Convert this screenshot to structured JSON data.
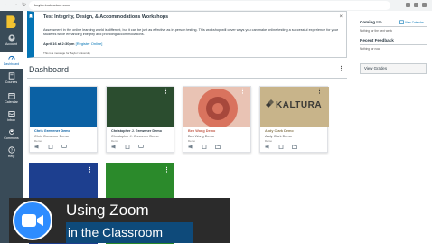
{
  "browser": {
    "url": "baylor.instructure.com"
  },
  "global_nav": {
    "items": [
      {
        "label": "Account",
        "icon": "account-icon"
      },
      {
        "label": "Dashboard",
        "icon": "dashboard-icon",
        "active": true
      },
      {
        "label": "Courses",
        "icon": "courses-icon"
      },
      {
        "label": "Calendar",
        "icon": "calendar-icon"
      },
      {
        "label": "Inbox",
        "icon": "inbox-icon"
      },
      {
        "label": "Commons",
        "icon": "commons-icon"
      },
      {
        "label": "Help",
        "icon": "help-icon"
      }
    ]
  },
  "announcement": {
    "title": "Test Integrity, Design, & Accommodations Workshops",
    "body": "Assessment in the online learning world is different, but it can be just as effective as in-person testing. This workshop will cover ways you can make online testing a successful experience for your students while enhancing integrity and providing accommodations.",
    "date_prefix": "April 16 at 2:30pm",
    "link": "[Register Online]",
    "footer": "This is a message for Baylor University",
    "close": "×"
  },
  "dashboard": {
    "title": "Dashboard",
    "menu": "⋮",
    "cards": [
      {
        "name": "Chris Grewener Demo",
        "sub": "Chris Grewener Demo",
        "term": "Demo",
        "color": "#0b61a4"
      },
      {
        "name": "Christopher J. Grewener Demo",
        "sub": "Christopher J. Grewener Demo",
        "term": "Demo",
        "color": "#2b4d2f"
      },
      {
        "name": "Ben Wong Demo",
        "sub": "Ben Wong Demo",
        "term": "Demo",
        "color": "#d9735e"
      },
      {
        "name": "Andy Clark Demo",
        "sub": "Andy Clark Demo",
        "term": "Demo",
        "color": "#c8b48a",
        "logo_text": "KALTURA"
      }
    ],
    "row2_colors": [
      "#1d3f8f",
      "#2b8a2b"
    ]
  },
  "sidebar": {
    "coming_up": "Coming Up",
    "view_calendar": "View Calendar",
    "nothing_next_week": "Nothing for the next week",
    "recent_feedback": "Recent Feedback",
    "nothing_now": "Nothing for now",
    "view_grades": "View Grades"
  },
  "overlay": {
    "line1": "Using Zoom",
    "line2": "in the Classroom"
  }
}
